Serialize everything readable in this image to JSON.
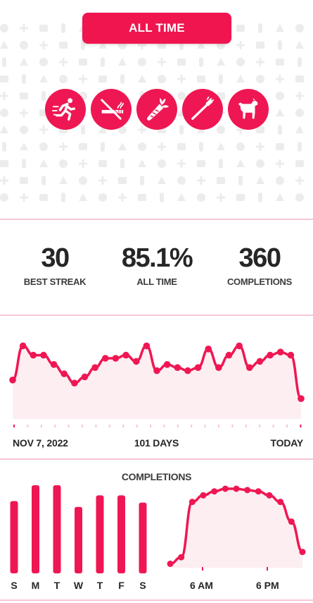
{
  "header": {
    "period_label": "ALL TIME"
  },
  "habits": [
    {
      "icon": "running-person-icon"
    },
    {
      "icon": "no-smoking-icon"
    },
    {
      "icon": "carrot-icon"
    },
    {
      "icon": "toothbrush-icon"
    },
    {
      "icon": "dog-icon"
    }
  ],
  "stats": {
    "best_streak": {
      "value": "30",
      "label": "BEST STREAK"
    },
    "all_time": {
      "value": "85.1%",
      "label": "ALL TIME"
    },
    "completions": {
      "value": "360",
      "label": "COMPLETIONS"
    }
  },
  "trend": {
    "start_label": "NOV 7, 2022",
    "span_label": "101 DAYS",
    "end_label": "TODAY"
  },
  "distribution": {
    "title": "COMPLETIONS",
    "weekday_labels": [
      "S",
      "M",
      "T",
      "W",
      "T",
      "F",
      "S"
    ],
    "hour_labels": [
      "6 AM",
      "6 PM"
    ]
  },
  "colors": {
    "accent": "#ef1753",
    "rule": "#f6c6d3",
    "area_fill": "#fdeef2",
    "pattern_icon": "#ececec"
  },
  "chart_data": [
    {
      "type": "line",
      "series": [
        {
          "values": [
            0.83,
            0.94,
            0.91,
            0.91,
            0.88,
            0.85,
            0.82,
            0.84,
            0.87,
            0.9,
            0.9,
            0.91,
            0.89,
            0.94,
            0.86,
            0.88,
            0.87,
            0.86,
            0.87,
            0.93,
            0.87,
            0.91,
            0.94,
            0.87,
            0.89,
            0.91,
            0.92,
            0.91,
            0.77
          ]
        }
      ]
    },
    {
      "type": "bar",
      "categories": [
        "S",
        "M",
        "T",
        "W",
        "T",
        "F",
        "S"
      ],
      "values": [
        50,
        61,
        61,
        46,
        54,
        54,
        49
      ]
    },
    {
      "type": "area",
      "series": [
        {
          "values": [
            3,
            8,
            50,
            55,
            58,
            60,
            60,
            59,
            58,
            55,
            50,
            35,
            12
          ]
        }
      ]
    }
  ]
}
